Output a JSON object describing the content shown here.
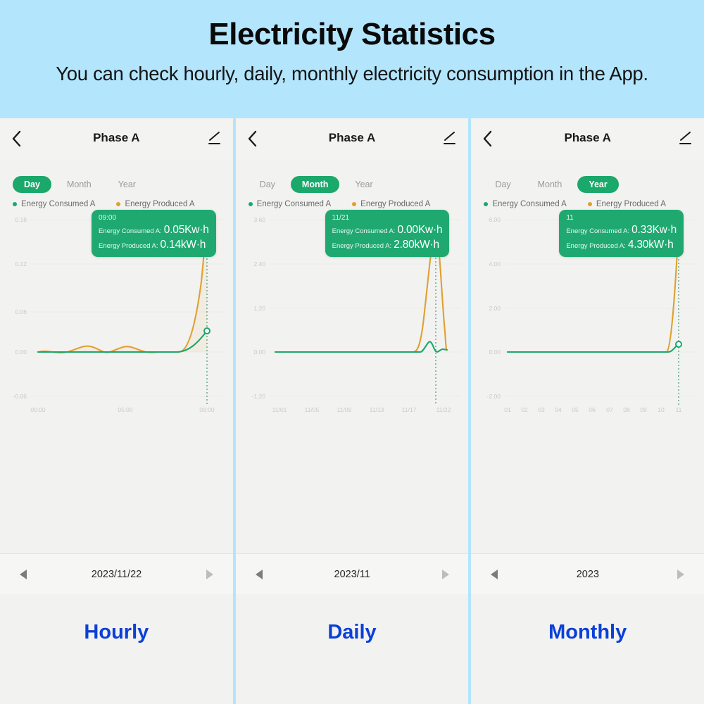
{
  "header": {
    "title": "Electricity Statistics",
    "subtitle": "You can check hourly, daily, monthly electricity consumption in the App.",
    "background_color": "#b3e5fc"
  },
  "theme": {
    "accent_green": "#1aa86b",
    "accent_orange": "#e0a030",
    "caption_blue": "#0b40d8",
    "panel_bg": "#f2f2f0"
  },
  "panels": [
    {
      "nav": {
        "back_icon": "chevron-left-icon",
        "title": "Phase A",
        "edit_icon": "pencil-edit-icon"
      },
      "tabs": [
        {
          "label": "Day",
          "active": true
        },
        {
          "label": "Month",
          "active": false
        },
        {
          "label": "Year",
          "active": false
        }
      ],
      "legend": [
        {
          "label": "Energy Consumed A",
          "color": "#1aa86b"
        },
        {
          "label": "Energy Produced A",
          "color": "#e0a030"
        }
      ],
      "tooltip": {
        "time": "09:00",
        "rows": [
          {
            "label": "Energy Consumed A:",
            "value": "0.05Kw·h"
          },
          {
            "label": "Energy Produced A:",
            "value": "0.14kW·h"
          }
        ]
      },
      "date": {
        "prev_icon": "triangle-left-icon",
        "value": "2023/11/22",
        "next_icon": "triangle-right-icon"
      },
      "caption": "Hourly",
      "chart_data": {
        "type": "line",
        "title": "Phase A — Day",
        "xlabel": "",
        "ylabel": "",
        "ylim": [
          -0.06,
          0.18
        ],
        "yticks": [
          "-0.06",
          "0.00",
          "0.06",
          "0.12",
          "0.18"
        ],
        "xticks": [
          "00:00",
          "05:00",
          "09:00"
        ],
        "grid": true,
        "legend_position": "top-left",
        "highlight_x": "09:00",
        "series": [
          {
            "name": "Energy Consumed A",
            "color": "#1aa86b",
            "x": [
              "00:00",
              "01:00",
              "02:00",
              "03:00",
              "04:00",
              "05:00",
              "06:00",
              "07:00",
              "08:00",
              "09:00"
            ],
            "values": [
              0.0,
              0.0,
              0.0,
              0.0,
              0.0,
              0.0,
              0.0,
              0.0,
              0.0,
              0.05
            ]
          },
          {
            "name": "Energy Produced A",
            "color": "#e0a030",
            "x": [
              "00:00",
              "01:00",
              "02:00",
              "03:00",
              "04:00",
              "05:00",
              "06:00",
              "07:00",
              "08:00",
              "09:00"
            ],
            "values": [
              0.005,
              0.0,
              0.008,
              0.0,
              0.008,
              0.0,
              0.0,
              0.0,
              0.055,
              0.14
            ]
          }
        ]
      }
    },
    {
      "nav": {
        "back_icon": "chevron-left-icon",
        "title": "Phase A",
        "edit_icon": "pencil-edit-icon"
      },
      "tabs": [
        {
          "label": "Day",
          "active": false
        },
        {
          "label": "Month",
          "active": true
        },
        {
          "label": "Year",
          "active": false
        }
      ],
      "legend": [
        {
          "label": "Energy Consumed A",
          "color": "#1aa86b"
        },
        {
          "label": "Energy Produced A",
          "color": "#e0a030"
        }
      ],
      "tooltip": {
        "time": "11/21",
        "rows": [
          {
            "label": "Energy Consumed A:",
            "value": "0.00Kw·h"
          },
          {
            "label": "Energy Produced A:",
            "value": "2.80kW·h"
          }
        ]
      },
      "date": {
        "prev_icon": "triangle-left-icon",
        "value": "2023/11",
        "next_icon": "triangle-right-icon"
      },
      "caption": "Daily",
      "chart_data": {
        "type": "line",
        "title": "Phase A — Month",
        "xlabel": "",
        "ylabel": "",
        "ylim": [
          -1.2,
          3.6
        ],
        "yticks": [
          "-1.20",
          "0.00",
          "1.20",
          "2.40",
          "3.60"
        ],
        "xticks": [
          "11/01",
          "11/05",
          "11/09",
          "11/13",
          "11/17",
          "11/22"
        ],
        "grid": true,
        "legend_position": "top-left",
        "highlight_x": "11/21",
        "series": [
          {
            "name": "Energy Consumed A",
            "color": "#1aa86b",
            "x": [
              "11/01",
              "11/05",
              "11/09",
              "11/13",
              "11/17",
              "11/19",
              "11/20",
              "11/21",
              "11/22"
            ],
            "values": [
              0.0,
              0.0,
              0.0,
              0.0,
              0.0,
              0.0,
              0.35,
              0.0,
              0.1
            ]
          },
          {
            "name": "Energy Produced A",
            "color": "#e0a030",
            "x": [
              "11/01",
              "11/05",
              "11/09",
              "11/13",
              "11/17",
              "11/19",
              "11/20",
              "11/21",
              "11/22"
            ],
            "values": [
              0.0,
              0.0,
              0.0,
              0.0,
              0.0,
              0.0,
              0.3,
              2.8,
              0.4
            ]
          }
        ]
      }
    },
    {
      "nav": {
        "back_icon": "chevron-left-icon",
        "title": "Phase A",
        "edit_icon": "pencil-edit-icon"
      },
      "tabs": [
        {
          "label": "Day",
          "active": false
        },
        {
          "label": "Month",
          "active": false
        },
        {
          "label": "Year",
          "active": true
        }
      ],
      "legend": [
        {
          "label": "Energy Consumed A",
          "color": "#1aa86b"
        },
        {
          "label": "Energy Produced A",
          "color": "#e0a030"
        }
      ],
      "tooltip": {
        "time": "11",
        "rows": [
          {
            "label": "Energy Consumed A:",
            "value": "0.33Kw·h"
          },
          {
            "label": "Energy Produced A:",
            "value": "4.30kW·h"
          }
        ]
      },
      "date": {
        "prev_icon": "triangle-left-icon",
        "value": "2023",
        "next_icon": "triangle-right-icon"
      },
      "caption": "Monthly",
      "chart_data": {
        "type": "line",
        "title": "Phase A — Year",
        "xlabel": "",
        "ylabel": "",
        "ylim": [
          -2.0,
          6.0
        ],
        "yticks": [
          "-2.00",
          "0.00",
          "2.00",
          "4.00",
          "6.00"
        ],
        "xticks": [
          "01",
          "02",
          "03",
          "04",
          "05",
          "06",
          "07",
          "08",
          "09",
          "10",
          "11"
        ],
        "grid": true,
        "legend_position": "top-left",
        "highlight_x": "11",
        "series": [
          {
            "name": "Energy Consumed A",
            "color": "#1aa86b",
            "x": [
              "01",
              "02",
              "03",
              "04",
              "05",
              "06",
              "07",
              "08",
              "09",
              "10",
              "11"
            ],
            "values": [
              0.0,
              0.0,
              0.0,
              0.0,
              0.0,
              0.0,
              0.0,
              0.0,
              0.0,
              0.0,
              0.33
            ]
          },
          {
            "name": "Energy Produced A",
            "color": "#e0a030",
            "x": [
              "01",
              "02",
              "03",
              "04",
              "05",
              "06",
              "07",
              "08",
              "09",
              "10",
              "11"
            ],
            "values": [
              0.0,
              0.0,
              0.0,
              0.0,
              0.0,
              0.0,
              0.0,
              0.0,
              0.0,
              0.0,
              4.3
            ]
          }
        ]
      }
    }
  ]
}
